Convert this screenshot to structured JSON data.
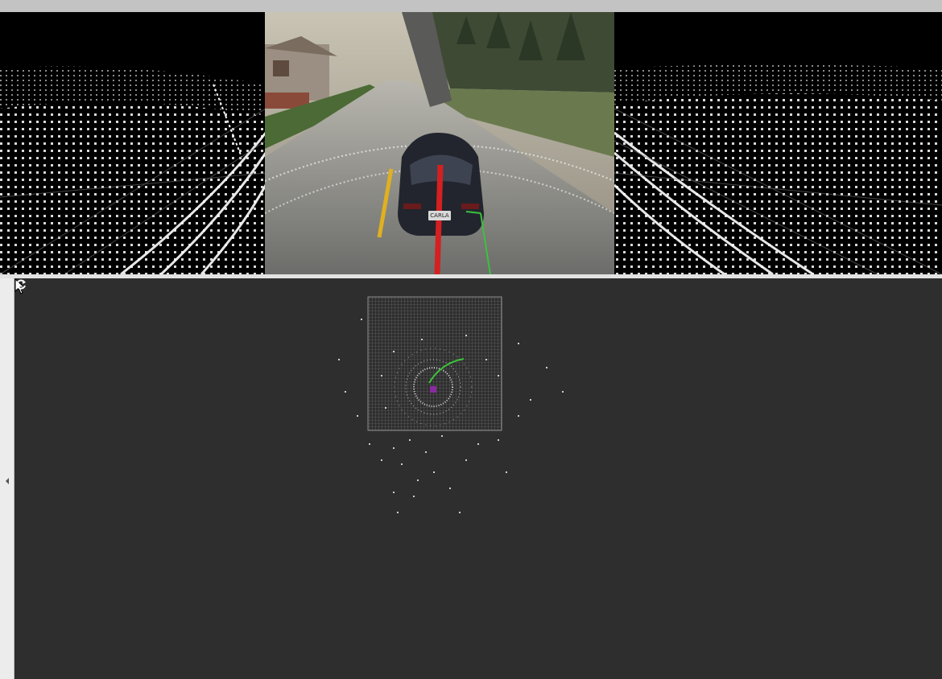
{
  "window": {
    "title": ""
  },
  "camera": {
    "license_plate": "CARLA"
  },
  "icons": {
    "cursor": "mouse-pointer-icon",
    "reload": "rotate-icon",
    "collapse": "chevron-left-icon"
  },
  "colors": {
    "panel_background": "#2e2e2e",
    "top_bar": "#c3c3c3",
    "trajectory_red": "#d42020",
    "lane_yellow": "#e0b020",
    "axis_green": "#3cc23c",
    "point_cloud": "#ffffff"
  }
}
